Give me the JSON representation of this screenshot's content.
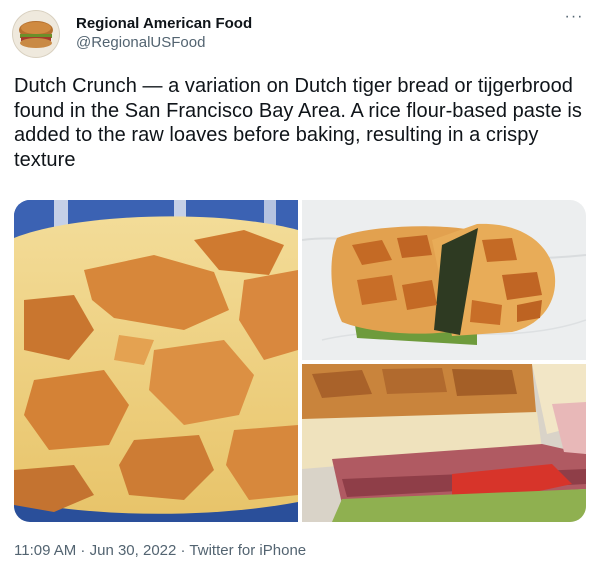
{
  "author": {
    "display_name": "Regional American Food",
    "handle": "@RegionalUSFood"
  },
  "tweet": {
    "text": "Dutch Crunch — a variation on Dutch tiger bread or tijgerbrood found in the San Francisco Bay Area. A rice flour-based paste is added to the raw loaves before baking, resulting in a crispy texture"
  },
  "icons": {
    "more": "more-options-icon"
  },
  "more_glyph": "···",
  "footer": {
    "time": "11:09 AM",
    "separator1": " · ",
    "date": "Jun 30, 2022",
    "separator2": " · ",
    "source": "Twitter for iPhone"
  },
  "colors": {
    "text_primary": "#0f1419",
    "text_secondary": "#536471"
  }
}
